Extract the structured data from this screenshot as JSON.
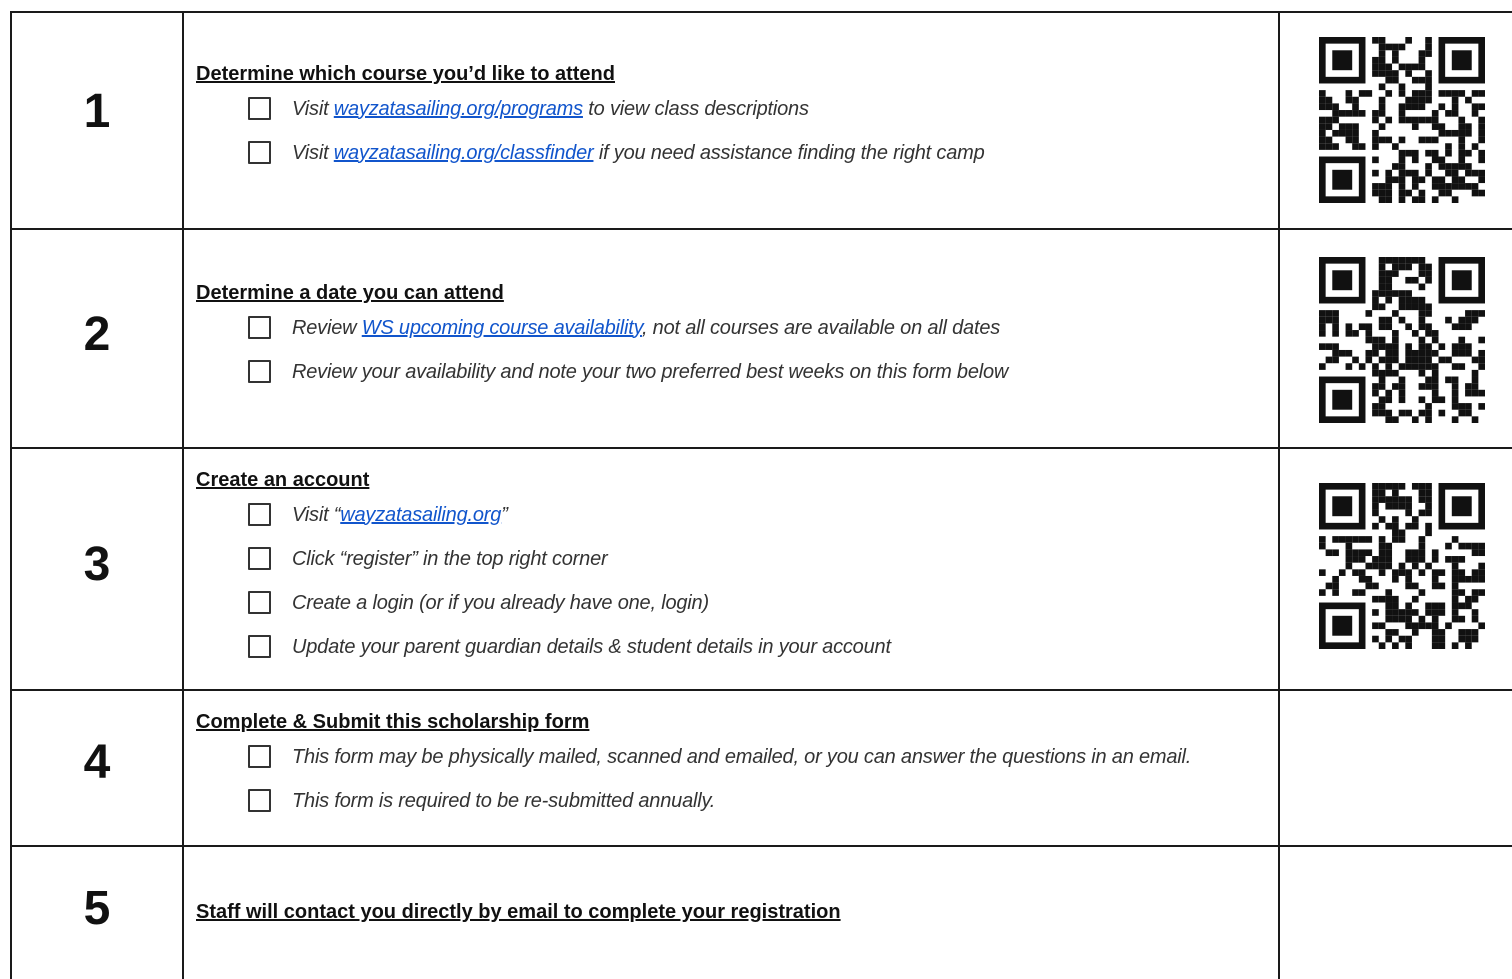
{
  "steps": [
    {
      "number": "1",
      "heading": "Determine which course you’d like to attend",
      "items": [
        {
          "pre": "Visit ",
          "link": "wayzatasailing.org/programs",
          "post": " to view class descriptions"
        },
        {
          "pre": "Visit ",
          "link": "wayzatasailing.org/classfinder",
          "post": "  if you need assistance finding  the right camp"
        }
      ],
      "qr_icon": "qr-code-icon"
    },
    {
      "number": "2",
      "heading": "Determine a date you can attend",
      "items": [
        {
          "pre": "Review ",
          "link": "WS upcoming course availability",
          "post": ", not all courses are available on all dates"
        },
        {
          "pre": "Review your availability and note your two preferred best weeks on this  form below",
          "link": "",
          "post": ""
        }
      ],
      "qr_icon": "qr-code-icon"
    },
    {
      "number": "3",
      "heading": "Create an account",
      "items": [
        {
          "pre": "Visit “",
          "link": "wayzatasailing.org",
          "post": "”"
        },
        {
          "pre": "Click “register” in the top right corner",
          "link": "",
          "post": ""
        },
        {
          "pre": "Create a login (or if you already have one, login)",
          "link": "",
          "post": ""
        },
        {
          "pre": "Update your parent guardian details & student details in  your account",
          "link": "",
          "post": ""
        }
      ],
      "qr_icon": "qr-code-icon"
    },
    {
      "number": "4",
      "heading": "Complete & Submit this scholarship form",
      "items": [
        {
          "pre": "This form may be physically mailed, scanned and emailed, or you can answer the questions in an email.",
          "link": "",
          "post": ""
        },
        {
          "pre": "This form is required to be re-submitted annually.",
          "link": "",
          "post": ""
        }
      ]
    },
    {
      "number": "5",
      "heading": "Staff will contact you directly by email to complete your registration",
      "items": []
    }
  ],
  "colors": {
    "border": "#1a1a1a",
    "link": "#1155cc",
    "text": "#333333"
  }
}
